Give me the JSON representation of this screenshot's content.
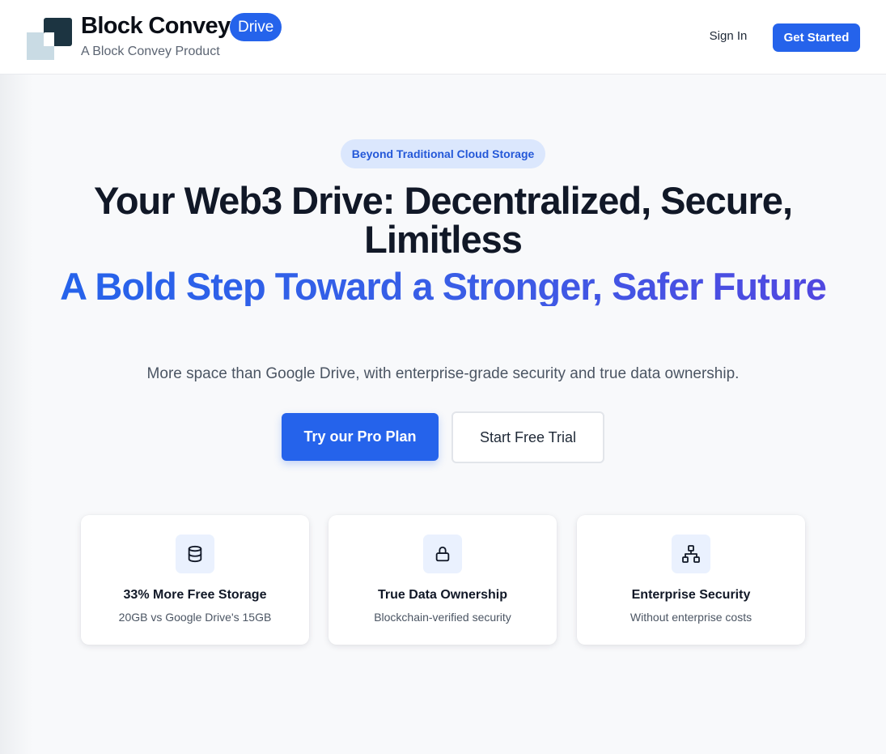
{
  "header": {
    "brand_name": "Block Convey",
    "badge": "Drive",
    "tagline": "A Block Convey Product",
    "sign_in": "Sign In",
    "get_started": "Get Started"
  },
  "hero": {
    "pill": "Beyond Traditional Cloud Storage",
    "headline": "Your Web3 Drive: Decentralized, Secure, Limitless",
    "subheadline": "A Bold Step Toward a Stronger, Safer Future",
    "lede": "More space than Google Drive, with enterprise-grade security and true data ownership.",
    "primary_cta": "Try our Pro Plan",
    "secondary_cta": "Start Free Trial"
  },
  "features": [
    {
      "icon": "database-icon",
      "title": "33% More Free Storage",
      "desc": "20GB vs Google Drive's 15GB"
    },
    {
      "icon": "lock-icon",
      "title": "True Data Ownership",
      "desc": "Blockchain-verified security"
    },
    {
      "icon": "network-icon",
      "title": "Enterprise Security",
      "desc": "Without enterprise costs"
    }
  ],
  "colors": {
    "accent": "#2563eb",
    "pill_bg": "#dbe7fd",
    "logo_dark": "#1c3441",
    "logo_light": "#c9dbe4"
  }
}
